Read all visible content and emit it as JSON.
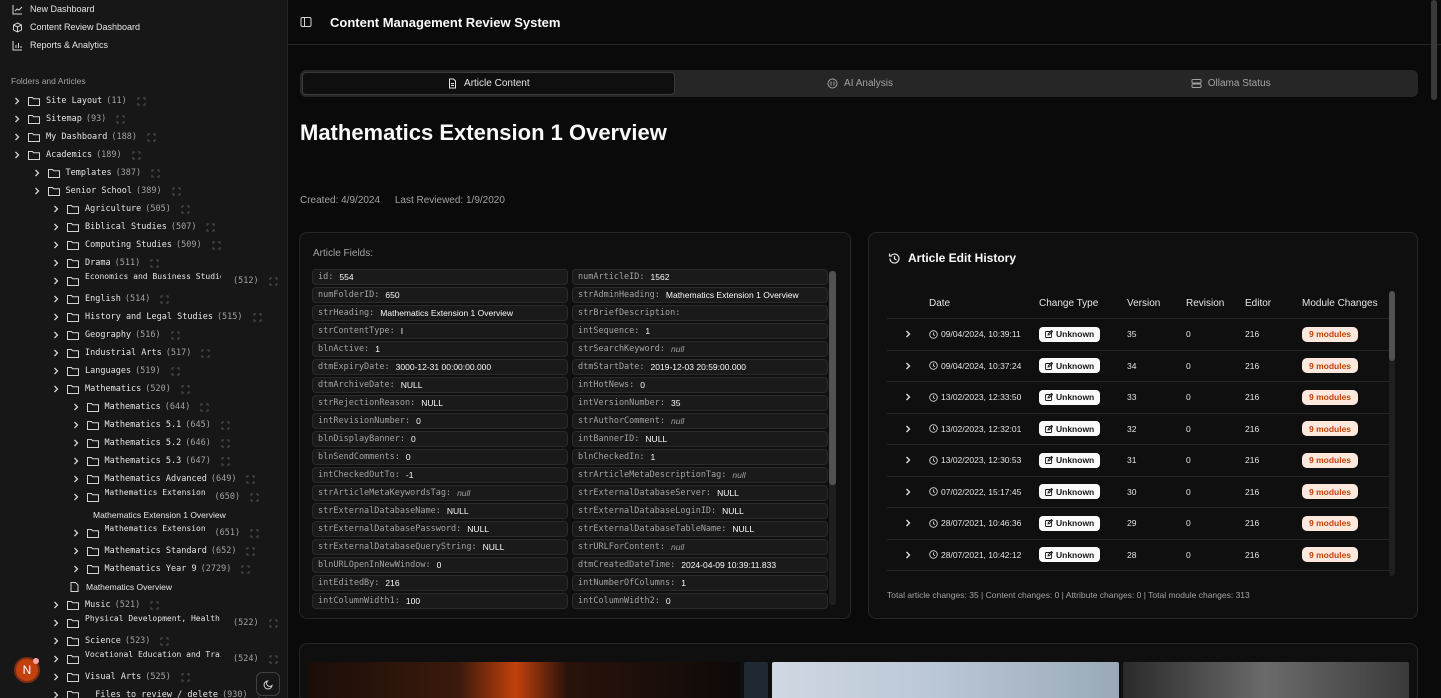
{
  "top_nav": [
    {
      "label": "New Dashboard",
      "icon": "chart-icon"
    },
    {
      "label": "Content Review Dashboard",
      "icon": "box-icon"
    },
    {
      "label": "Reports & Analytics",
      "icon": "bar-chart-icon"
    }
  ],
  "sidebar": {
    "section_label": "Folders and Articles",
    "tree": [
      {
        "type": "folder",
        "depth": 0,
        "label": "Site Layout",
        "count": "(11)"
      },
      {
        "type": "folder",
        "depth": 0,
        "label": "Sitemap",
        "count": "(93)"
      },
      {
        "type": "folder",
        "depth": 0,
        "label": "My Dashboard",
        "count": "(188)"
      },
      {
        "type": "folder",
        "depth": 0,
        "label": "Academics",
        "count": "(189)"
      },
      {
        "type": "folder",
        "depth": 1,
        "label": "Templates",
        "count": "(387)"
      },
      {
        "type": "folder",
        "depth": 1,
        "label": "Senior School",
        "count": "(389)"
      },
      {
        "type": "folder",
        "depth": 2,
        "label": "Agriculture",
        "count": "(505)"
      },
      {
        "type": "folder",
        "depth": 2,
        "label": "Biblical Studies",
        "count": "(507)"
      },
      {
        "type": "folder",
        "depth": 2,
        "label": "Computing Studies",
        "count": "(509)"
      },
      {
        "type": "folder",
        "depth": 2,
        "label": "Drama",
        "count": "(511)"
      },
      {
        "type": "folder2",
        "depth": 2,
        "label": "Economics and Business Studies",
        "count": "(512)"
      },
      {
        "type": "folder",
        "depth": 2,
        "label": "English",
        "count": "(514)"
      },
      {
        "type": "folder",
        "depth": 2,
        "label": "History and Legal Studies",
        "count": "(515)"
      },
      {
        "type": "folder",
        "depth": 2,
        "label": "Geography",
        "count": "(516)"
      },
      {
        "type": "folder",
        "depth": 2,
        "label": "Industrial Arts",
        "count": "(517)"
      },
      {
        "type": "folder",
        "depth": 2,
        "label": "Languages",
        "count": "(519)"
      },
      {
        "type": "folder",
        "depth": 2,
        "label": "Mathematics",
        "count": "(520)"
      },
      {
        "type": "folder",
        "depth": 3,
        "label": "Mathematics",
        "count": "(644)"
      },
      {
        "type": "folder",
        "depth": 3,
        "label": "Mathematics 5.1",
        "count": "(645)"
      },
      {
        "type": "folder",
        "depth": 3,
        "label": "Mathematics 5.2",
        "count": "(646)"
      },
      {
        "type": "folder",
        "depth": 3,
        "label": "Mathematics 5.3",
        "count": "(647)"
      },
      {
        "type": "folder",
        "depth": 3,
        "label": "Mathematics Advanced",
        "count": "(649)"
      },
      {
        "type": "folder2",
        "depth": 3,
        "label": "Mathematics Extension 1",
        "count": "(650)"
      },
      {
        "type": "file",
        "depth": 4,
        "label": "Mathematics Extension 1 Overview",
        "count": ""
      },
      {
        "type": "folder2",
        "depth": 3,
        "label": "Mathematics Extension 2",
        "count": "(651)"
      },
      {
        "type": "folder",
        "depth": 3,
        "label": "Mathematics Standard",
        "count": "(652)"
      },
      {
        "type": "folder",
        "depth": 3,
        "label": "Mathematics Year 9",
        "count": "(2729)"
      },
      {
        "type": "file",
        "depth": 3,
        "label": "Mathematics Overview",
        "count": ""
      },
      {
        "type": "folder",
        "depth": 2,
        "label": "Music",
        "count": "(521)"
      },
      {
        "type": "folder2",
        "depth": 2,
        "label": "Physical Development, Health and Physical Education",
        "count": "(522)"
      },
      {
        "type": "folder",
        "depth": 2,
        "label": "Science",
        "count": "(523)"
      },
      {
        "type": "folder2",
        "depth": 2,
        "label": "Vocational Education and Training",
        "count": "(524)"
      },
      {
        "type": "folder",
        "depth": 2,
        "label": "Visual Arts",
        "count": "(525)"
      },
      {
        "type": "folder",
        "depth": 2,
        "label": "__Files to review / delete",
        "count": "(930)"
      }
    ],
    "avatar_letter": "N"
  },
  "header": {
    "title": "Content Management Review System"
  },
  "tabs": [
    {
      "label": "Article Content",
      "icon": "document-icon",
      "active": true
    },
    {
      "label": "AI Analysis",
      "icon": "ai-icon",
      "active": false
    },
    {
      "label": "Ollama Status",
      "icon": "server-icon",
      "active": false
    }
  ],
  "article": {
    "title": "Mathematics Extension 1 Overview",
    "created": "Created: 4/9/2024",
    "reviewed": "Last Reviewed: 1/9/2020"
  },
  "fields_caption": "Article Fields:",
  "fields": [
    {
      "k": "id:",
      "v": "554"
    },
    {
      "k": "numArticleID:",
      "v": "1562"
    },
    {
      "k": "numFolderID:",
      "v": "650"
    },
    {
      "k": "strAdminHeading:",
      "v": "Mathematics Extension 1 Overview"
    },
    {
      "k": "strHeading:",
      "v": "Mathematics Extension 1 Overview"
    },
    {
      "k": "strBriefDescription:",
      "v": ""
    },
    {
      "k": "strContentType:",
      "v": "I"
    },
    {
      "k": "intSequence:",
      "v": "1"
    },
    {
      "k": "blnActive:",
      "v": "1"
    },
    {
      "k": "strSearchKeyword:",
      "v": "null",
      "null": true
    },
    {
      "k": "dtmExpiryDate:",
      "v": "3000-12-31 00:00:00.000"
    },
    {
      "k": "dtmStartDate:",
      "v": "2019-12-03 20:59:00.000"
    },
    {
      "k": "dtmArchiveDate:",
      "v": "NULL"
    },
    {
      "k": "intHotNews:",
      "v": "0"
    },
    {
      "k": "strRejectionReason:",
      "v": "NULL"
    },
    {
      "k": "intVersionNumber:",
      "v": "35"
    },
    {
      "k": "intRevisionNumber:",
      "v": "0"
    },
    {
      "k": "strAuthorComment:",
      "v": "null",
      "null": true
    },
    {
      "k": "blnDisplayBanner:",
      "v": "0"
    },
    {
      "k": "intBannerID:",
      "v": "NULL"
    },
    {
      "k": "blnSendComments:",
      "v": "0"
    },
    {
      "k": "blnCheckedIn:",
      "v": "1"
    },
    {
      "k": "intCheckedOutTo:",
      "v": "-1"
    },
    {
      "k": "strArticleMetaDescriptionTag:",
      "v": "null",
      "null": true
    },
    {
      "k": "strArticleMetaKeywordsTag:",
      "v": "null",
      "null": true
    },
    {
      "k": "strExternalDatabaseServer:",
      "v": "NULL"
    },
    {
      "k": "strExternalDatabaseName:",
      "v": "NULL"
    },
    {
      "k": "strExternalDatabaseLoginID:",
      "v": "NULL"
    },
    {
      "k": "strExternalDatabasePassword:",
      "v": "NULL"
    },
    {
      "k": "strExternalDatabaseTableName:",
      "v": "NULL"
    },
    {
      "k": "strExternalDatabaseQueryString:",
      "v": "NULL"
    },
    {
      "k": "strURLForContent:",
      "v": "null",
      "null": true
    },
    {
      "k": "blnURLOpenInNewWindow:",
      "v": "0"
    },
    {
      "k": "dtmCreatedDateTime:",
      "v": "2024-04-09 10:39:11.833"
    },
    {
      "k": "intEditedBy:",
      "v": "216"
    },
    {
      "k": "intNumberOfColumns:",
      "v": "1"
    },
    {
      "k": "intColumnWidth1:",
      "v": "100"
    },
    {
      "k": "intColumnWidth2:",
      "v": "0"
    }
  ],
  "history": {
    "title": "Article Edit History",
    "columns": [
      "Date",
      "Change Type",
      "Version",
      "Revision",
      "Editor",
      "Module Changes"
    ],
    "rows": [
      {
        "date": "09/04/2024, 10:39:11",
        "type": "Unknown",
        "version": "35",
        "revision": "0",
        "editor": "216",
        "modules": "9 modules"
      },
      {
        "date": "09/04/2024, 10:37:24",
        "type": "Unknown",
        "version": "34",
        "revision": "0",
        "editor": "216",
        "modules": "9 modules"
      },
      {
        "date": "13/02/2023, 12:33:50",
        "type": "Unknown",
        "version": "33",
        "revision": "0",
        "editor": "216",
        "modules": "9 modules"
      },
      {
        "date": "13/02/2023, 12:32:01",
        "type": "Unknown",
        "version": "32",
        "revision": "0",
        "editor": "216",
        "modules": "9 modules"
      },
      {
        "date": "13/02/2023, 12:30:53",
        "type": "Unknown",
        "version": "31",
        "revision": "0",
        "editor": "216",
        "modules": "9 modules"
      },
      {
        "date": "07/02/2022, 15:17:45",
        "type": "Unknown",
        "version": "30",
        "revision": "0",
        "editor": "216",
        "modules": "9 modules"
      },
      {
        "date": "28/07/2021, 10:46:36",
        "type": "Unknown",
        "version": "29",
        "revision": "0",
        "editor": "216",
        "modules": "9 modules"
      },
      {
        "date": "28/07/2021, 10:42:12",
        "type": "Unknown",
        "version": "28",
        "revision": "0",
        "editor": "216",
        "modules": "9 modules"
      }
    ],
    "footer": "Total article changes: 35 | Content changes: 0 | Attribute changes: 0 | Total module changes: 313"
  },
  "colors": {
    "accent_badge_bg": "#fde8dd",
    "accent_badge_text": "#c2410c",
    "avatar": "#c2410c"
  }
}
